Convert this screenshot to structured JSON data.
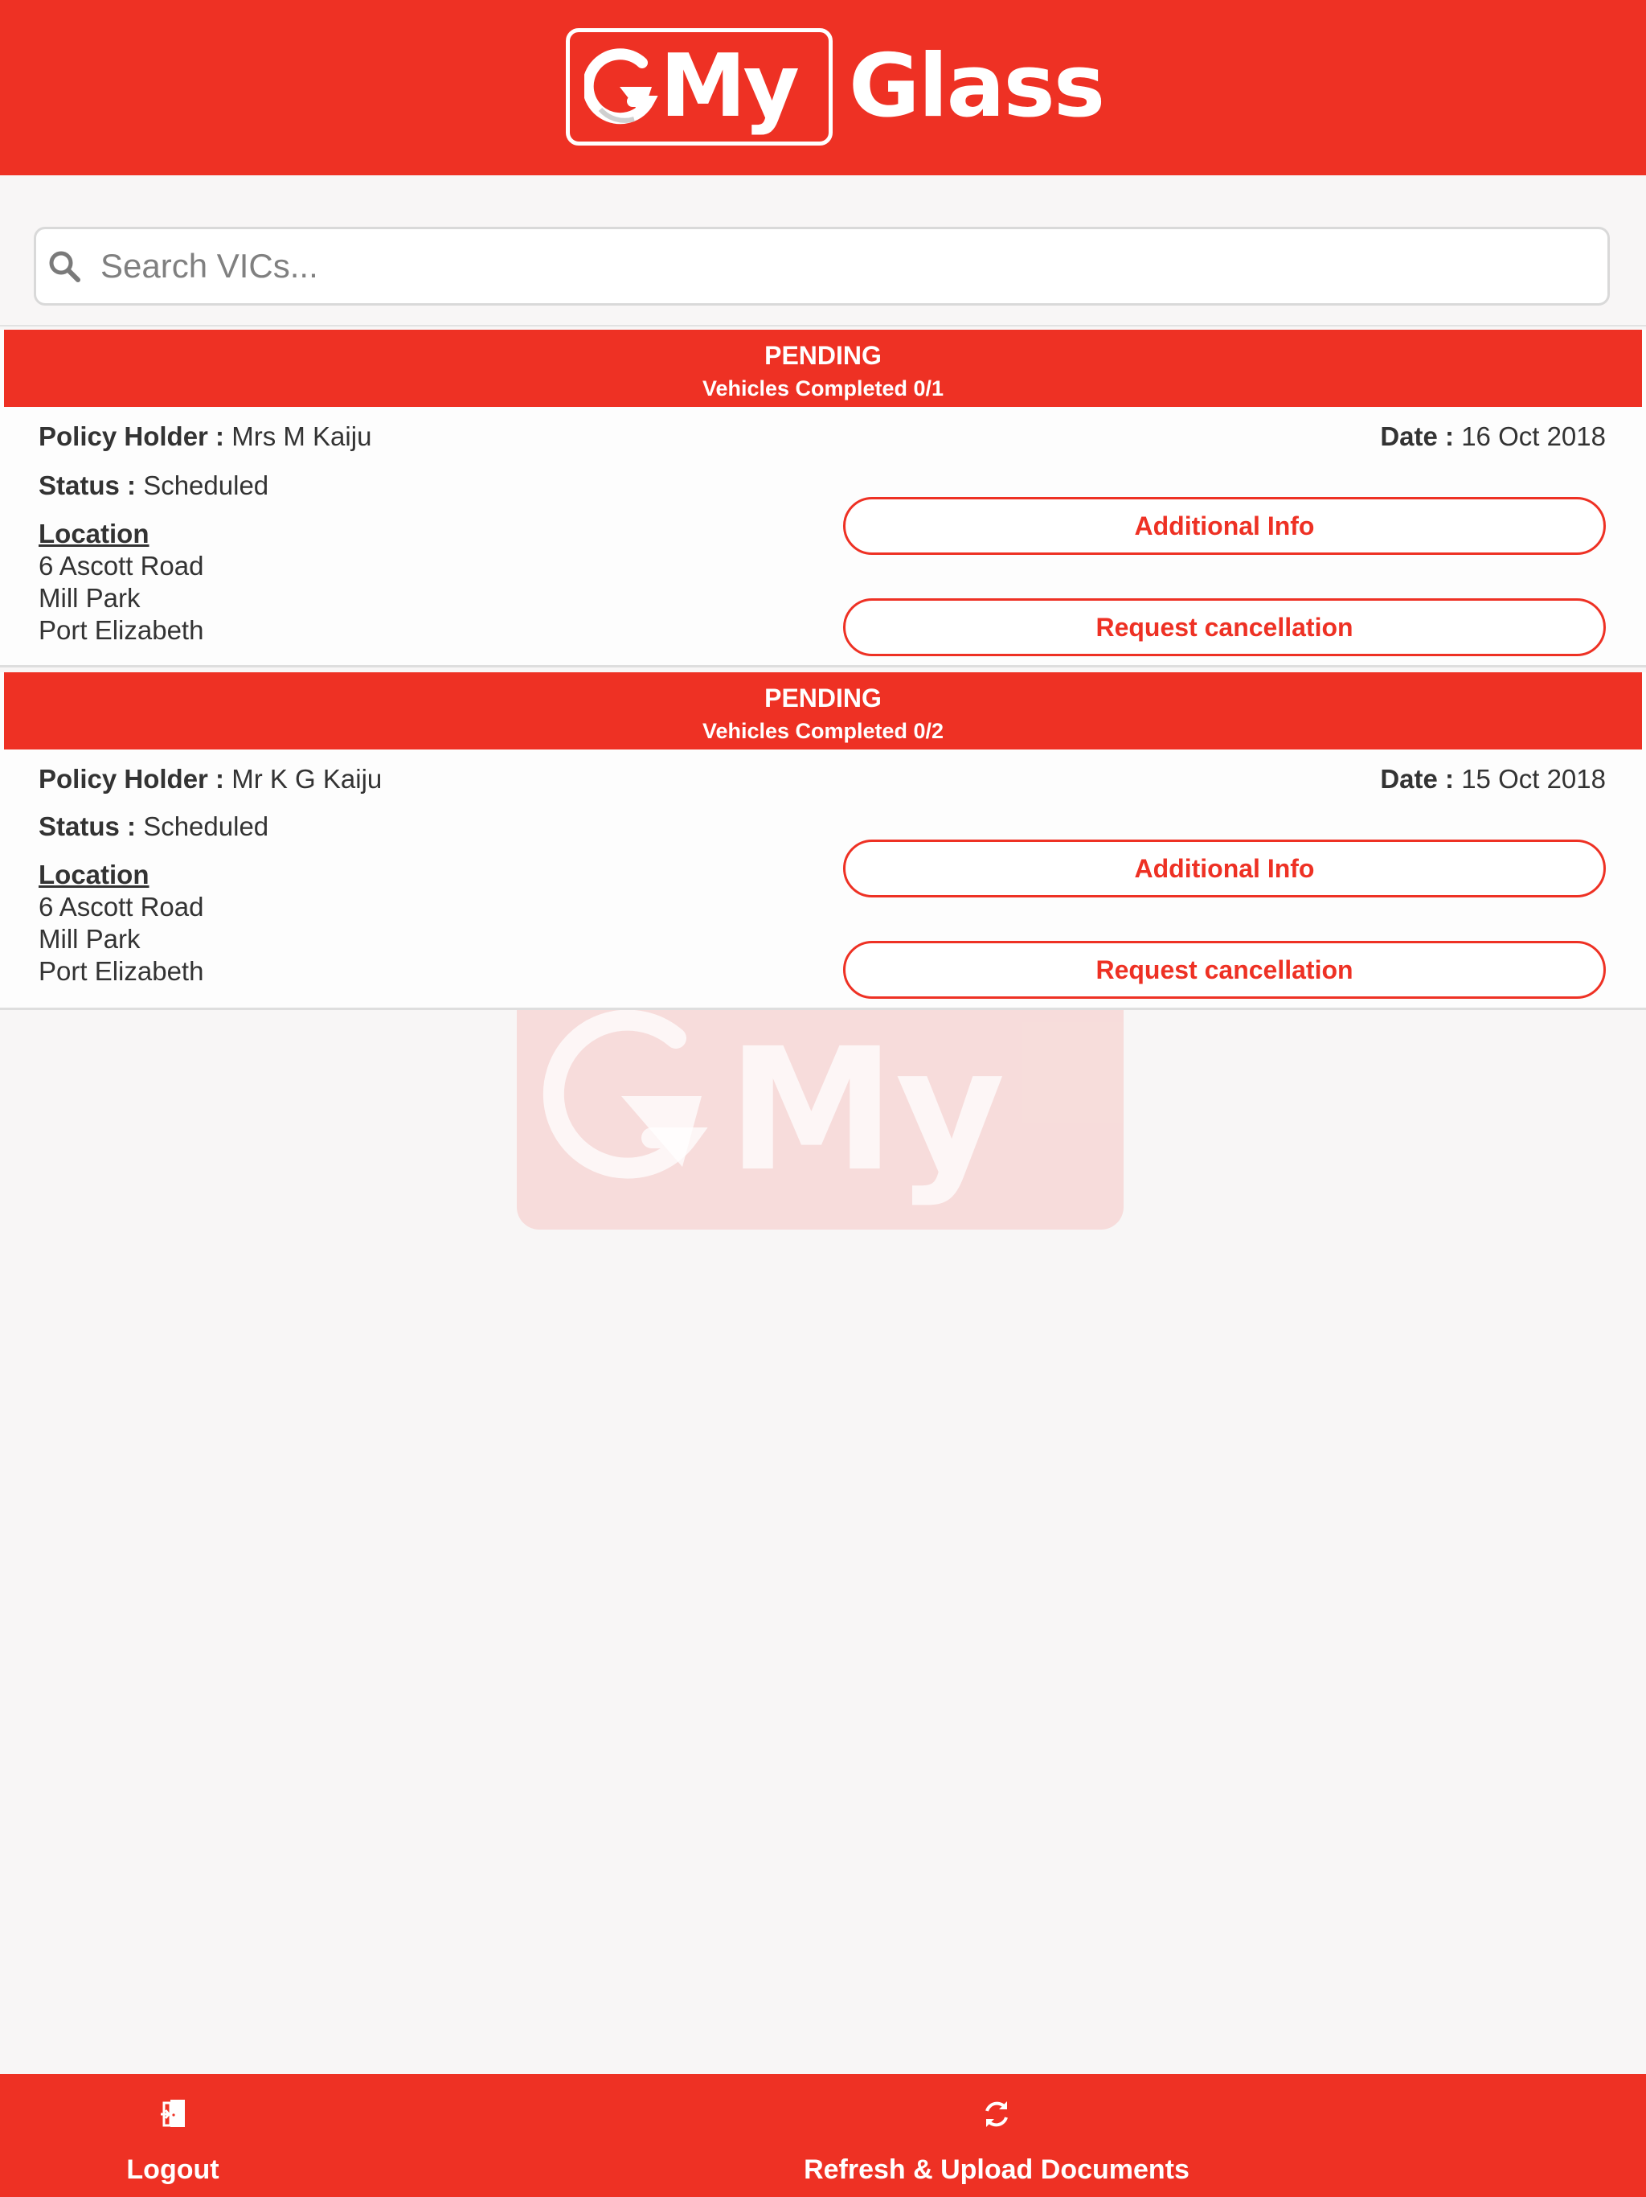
{
  "app": {
    "logo_text_my": "My",
    "logo_text_glass": "Glass",
    "brand_color": "#ee3124",
    "watermark_text": "My"
  },
  "search": {
    "placeholder": "Search VICs...",
    "value": "",
    "icon": "search-icon"
  },
  "cards": [
    {
      "status_title": "PENDING",
      "vehicles_completed": "Vehicles Completed 0/1",
      "policy_holder_label": "Policy Holder :",
      "policy_holder_value": "Mrs M Kaiju",
      "date_label": "Date :",
      "date_value": "16 Oct 2018",
      "status_label": "Status :",
      "status_value": "Scheduled",
      "location_heading": "Location",
      "location_lines": [
        "6 Ascott Road",
        "Mill Park",
        "Port Elizabeth"
      ],
      "additional_info_label": "Additional Info",
      "request_cancellation_label": "Request cancellation"
    },
    {
      "status_title": "PENDING",
      "vehicles_completed": "Vehicles Completed 0/2",
      "policy_holder_label": "Policy Holder :",
      "policy_holder_value": "Mr K G Kaiju",
      "date_label": "Date :",
      "date_value": "15 Oct 2018",
      "status_label": "Status :",
      "status_value": "Scheduled",
      "location_heading": "Location",
      "location_lines": [
        "6 Ascott Road",
        "Mill Park",
        "Port Elizabeth"
      ],
      "additional_info_label": "Additional Info",
      "request_cancellation_label": "Request cancellation"
    }
  ],
  "footer": {
    "logout_label": "Logout",
    "logout_icon": "logout-door-icon",
    "refresh_label": "Refresh & Upload Documents",
    "refresh_icon": "refresh-icon"
  }
}
